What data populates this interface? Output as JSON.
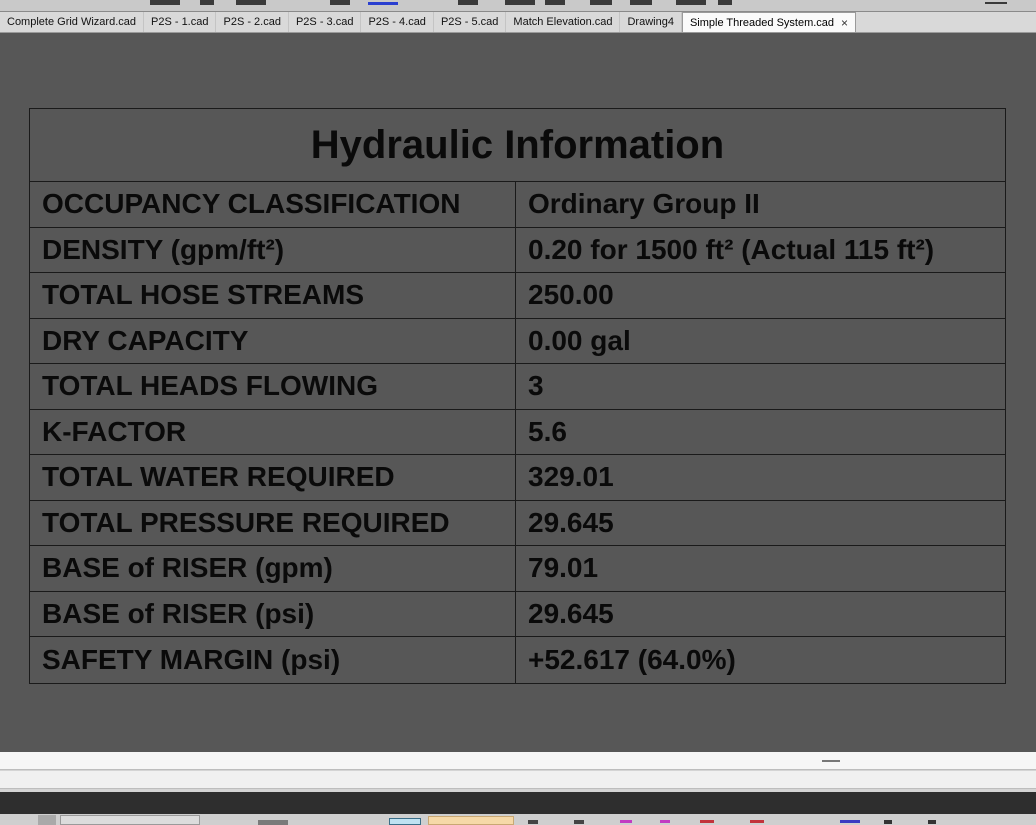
{
  "tabs": [
    {
      "label": "Complete Grid Wizard.cad",
      "active": false
    },
    {
      "label": "P2S - 1.cad",
      "active": false
    },
    {
      "label": "P2S - 2.cad",
      "active": false
    },
    {
      "label": "P2S - 3.cad",
      "active": false
    },
    {
      "label": "P2S - 4.cad",
      "active": false
    },
    {
      "label": "P2S - 5.cad",
      "active": false
    },
    {
      "label": "Match Elevation.cad",
      "active": false
    },
    {
      "label": "Drawing4",
      "active": false
    },
    {
      "label": "Simple Threaded System.cad",
      "active": true
    }
  ],
  "close_icon": "close-icon",
  "hydraulic_table": {
    "title": "Hydraulic Information",
    "rows": [
      {
        "label": "OCCUPANCY CLASSIFICATION",
        "value": "Ordinary Group II"
      },
      {
        "label": "DENSITY (gpm/ft²)",
        "value": "0.20 for 1500 ft² (Actual 115 ft²)"
      },
      {
        "label": "TOTAL HOSE STREAMS",
        "value": "250.00"
      },
      {
        "label": "DRY CAPACITY",
        "value": "0.00 gal"
      },
      {
        "label": "TOTAL HEADS FLOWING",
        "value": "3"
      },
      {
        "label": "K-FACTOR",
        "value": "5.6"
      },
      {
        "label": "TOTAL WATER REQUIRED",
        "value": "329.01"
      },
      {
        "label": "TOTAL PRESSURE REQUIRED",
        "value": "29.645"
      },
      {
        "label": "BASE of RISER (gpm)",
        "value": "79.01"
      },
      {
        "label": "BASE of RISER (psi)",
        "value": "29.645"
      },
      {
        "label": "SAFETY MARGIN (psi)",
        "value": "+52.617 (64.0%)"
      }
    ]
  },
  "colors": {
    "canvas_background": "#575757",
    "table_text": "#0a0a0a",
    "active_tab": "#fafafa"
  }
}
